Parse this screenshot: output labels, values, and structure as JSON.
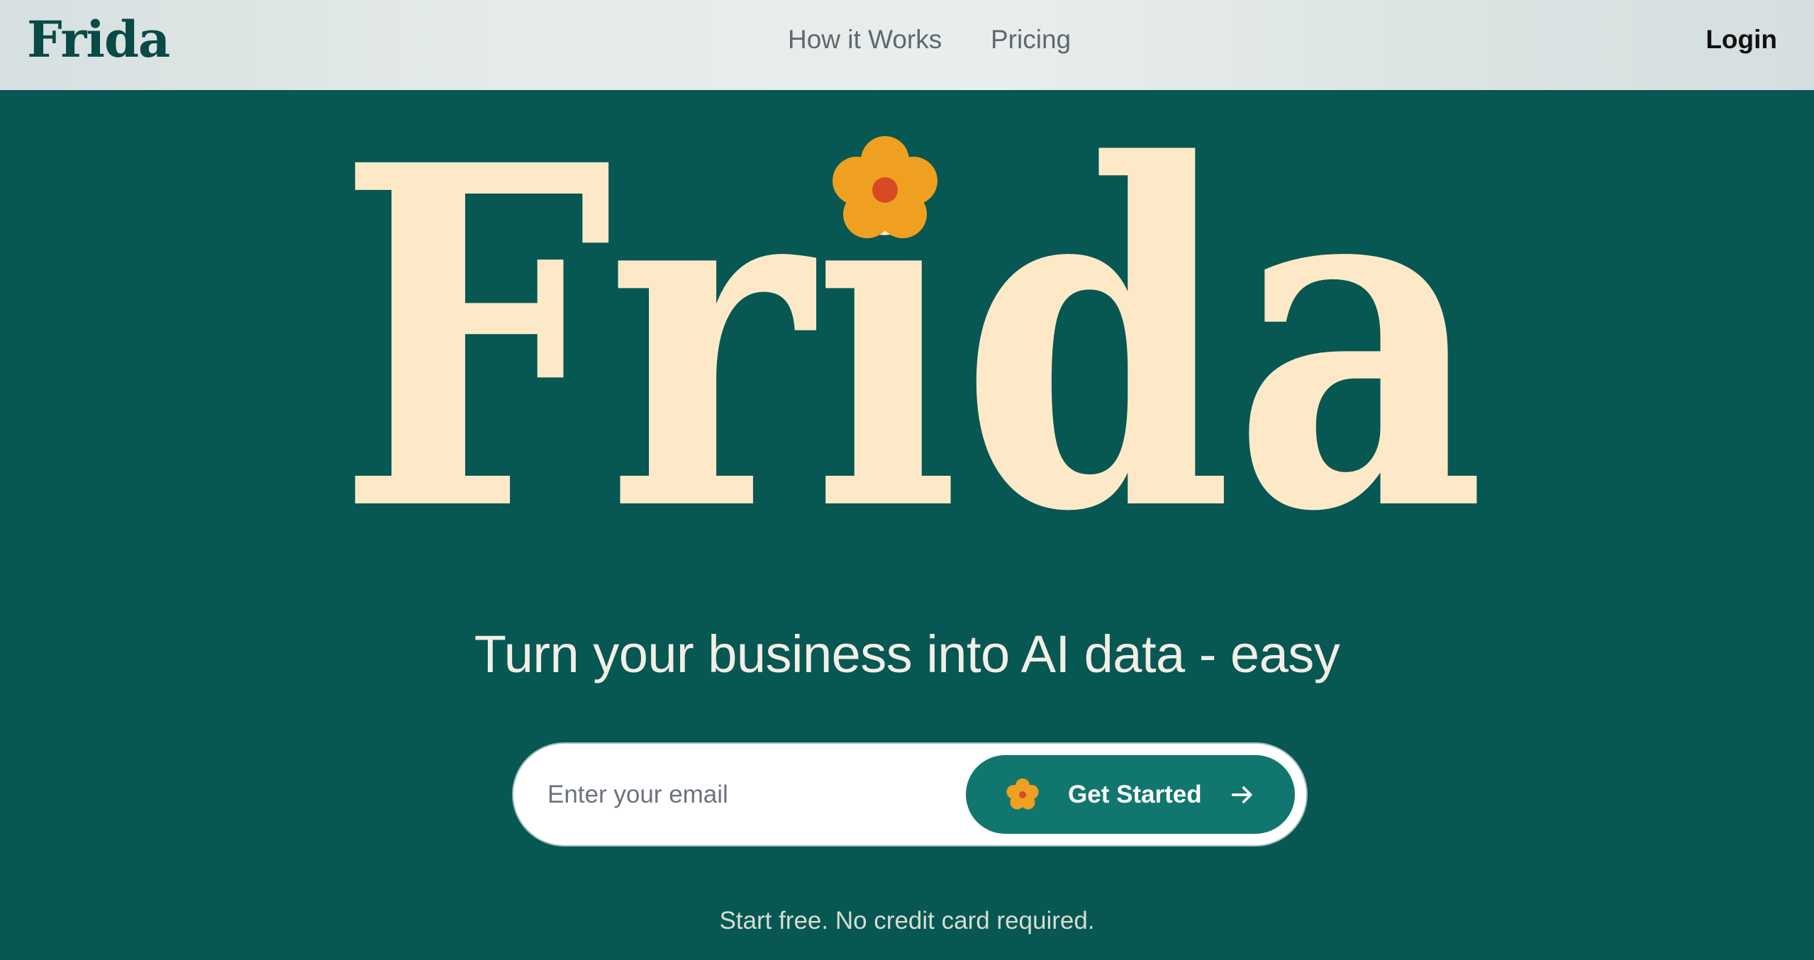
{
  "header": {
    "brand": "Frida",
    "nav": [
      {
        "label": "How it Works"
      },
      {
        "label": "Pricing"
      }
    ],
    "login_label": "Login"
  },
  "hero": {
    "wordmark": "Frida",
    "headline": "Turn your business into AI data - easy"
  },
  "signup": {
    "email_placeholder": "Enter your email",
    "cta_label": "Get Started",
    "cta_icon": "flower-icon",
    "cta_trailing_icon": "arrow-right-icon",
    "note": "Start free. No credit card required."
  },
  "colors": {
    "background": "#075753",
    "wordmark": "#fde9c7",
    "flower_petals": "#f0a020",
    "flower_center": "#d94a22",
    "cta": "#11776e"
  }
}
